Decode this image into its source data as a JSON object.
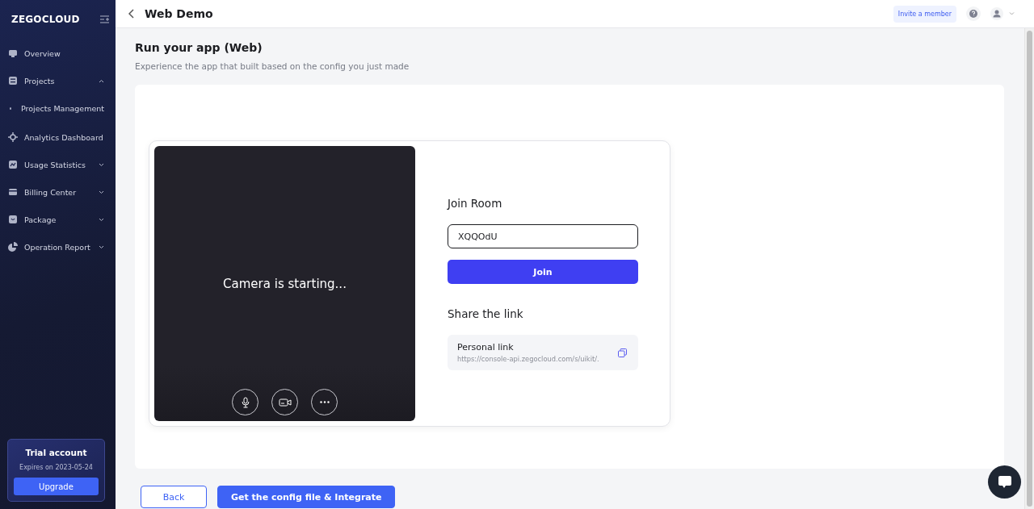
{
  "sidebar": {
    "logo": "ZEGOCLOUD",
    "items": [
      {
        "kind": "overview",
        "label": "Overview"
      },
      {
        "kind": "projects",
        "label": "Projects",
        "expanded": true,
        "children": [
          {
            "label": "Projects Management"
          }
        ]
      },
      {
        "kind": "analytics",
        "label": "Analytics Dashboard"
      },
      {
        "kind": "usage",
        "label": "Usage Statistics",
        "expanded": false
      },
      {
        "kind": "billing",
        "label": "Billing Center",
        "expanded": false
      },
      {
        "kind": "package",
        "label": "Package",
        "expanded": false
      },
      {
        "kind": "report",
        "label": "Operation Report",
        "expanded": false
      }
    ],
    "trial": {
      "title": "Trial account",
      "expires": "Expires on 2023-05-24",
      "button": "Upgrade"
    }
  },
  "header": {
    "title": "Web Demo",
    "invite": "Invite a member"
  },
  "page": {
    "title": "Run your app (Web)",
    "subtitle": "Experience the app that built based on the config you just made"
  },
  "demo": {
    "camera_status": "Camera is starting...",
    "join_title": "Join Room",
    "room_id": "XQQOdU",
    "join_button": "Join",
    "share_title": "Share the link",
    "link_label": "Personal link",
    "link_url": "https://console-api.zegocloud.com/s/uikit/."
  },
  "footer": {
    "buttons": [
      {
        "kind": "outline",
        "label": "Back"
      },
      {
        "kind": "primary",
        "label": "Get the config file & Integrate"
      }
    ]
  }
}
